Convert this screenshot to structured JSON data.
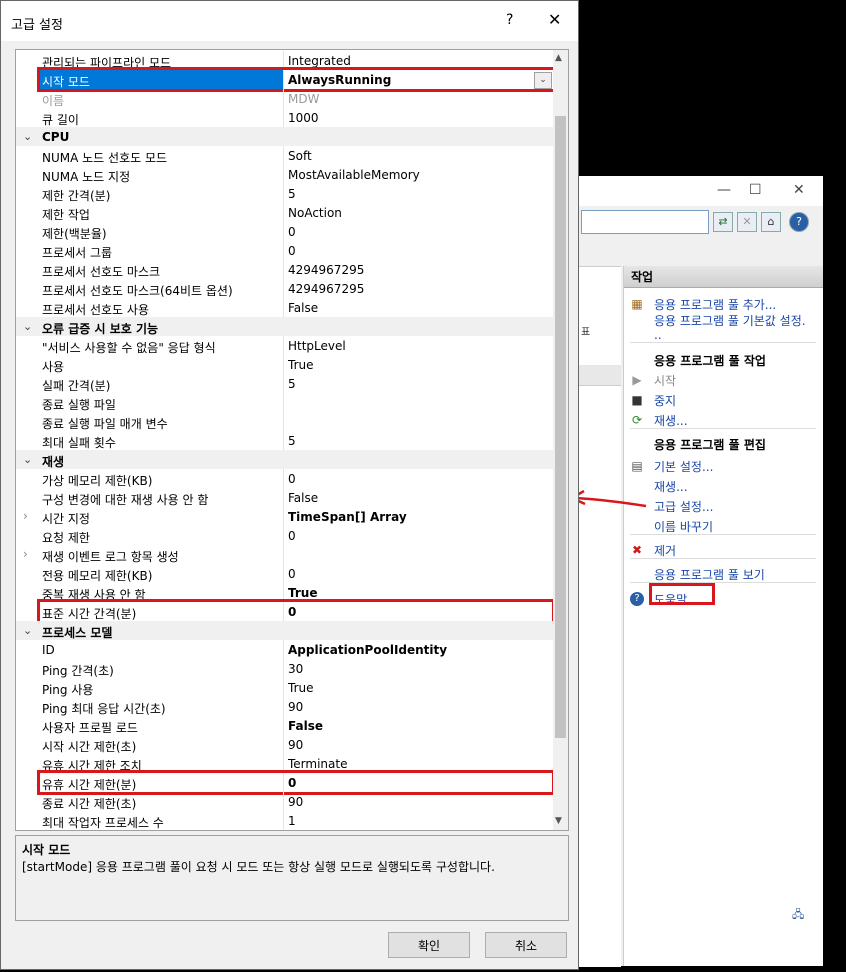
{
  "dialog": {
    "title": "고급 설정",
    "help_label": "?",
    "close_label": "✕",
    "ok_label": "확인",
    "cancel_label": "취소"
  },
  "grid": {
    "rows": [
      {
        "kind": "prop",
        "label": "관리되는 파이프라인 모드",
        "value": "Integrated"
      },
      {
        "kind": "prop",
        "label": "시작 모드",
        "value": "AlwaysRunning",
        "selected": true
      },
      {
        "kind": "prop",
        "label": "이름",
        "value": "MDW",
        "dim": true
      },
      {
        "kind": "prop",
        "label": "큐 길이",
        "value": "1000"
      },
      {
        "kind": "cat",
        "label": "CPU"
      },
      {
        "kind": "prop",
        "label": "NUMA 노드 선호도 모드",
        "value": "Soft"
      },
      {
        "kind": "prop",
        "label": "NUMA 노드 지정",
        "value": "MostAvailableMemory"
      },
      {
        "kind": "prop",
        "label": "제한 간격(분)",
        "value": "5"
      },
      {
        "kind": "prop",
        "label": "제한 작업",
        "value": "NoAction"
      },
      {
        "kind": "prop",
        "label": "제한(백분율)",
        "value": "0"
      },
      {
        "kind": "prop",
        "label": "프로세서 그룹",
        "value": "0"
      },
      {
        "kind": "prop",
        "label": "프로세서 선호도 마스크",
        "value": "4294967295"
      },
      {
        "kind": "prop",
        "label": "프로세서 선호도 마스크(64비트 옵션)",
        "value": "4294967295"
      },
      {
        "kind": "prop",
        "label": "프로세서 선호도 사용",
        "value": "False"
      },
      {
        "kind": "cat",
        "label": "오류 급증 시 보호 기능"
      },
      {
        "kind": "prop",
        "label": "\"서비스 사용할 수 없음\" 응답 형식",
        "value": "HttpLevel"
      },
      {
        "kind": "prop",
        "label": "사용",
        "value": "True"
      },
      {
        "kind": "prop",
        "label": "실패 간격(분)",
        "value": "5"
      },
      {
        "kind": "prop",
        "label": "종료 실행 파일",
        "value": ""
      },
      {
        "kind": "prop",
        "label": "종료 실행 파일 매개 변수",
        "value": ""
      },
      {
        "kind": "prop",
        "label": "최대 실패 횟수",
        "value": "5"
      },
      {
        "kind": "cat",
        "label": "재생"
      },
      {
        "kind": "prop",
        "label": "가상 메모리 제한(KB)",
        "value": "0"
      },
      {
        "kind": "prop",
        "label": "구성 변경에 대한 재생 사용 안 함",
        "value": "False"
      },
      {
        "kind": "prop",
        "label": "시간 지정",
        "value": "TimeSpan[] Array",
        "bold": true,
        "expander": true
      },
      {
        "kind": "prop",
        "label": "요청 제한",
        "value": "0"
      },
      {
        "kind": "prop",
        "label": "재생 이벤트 로그 항목 생성",
        "value": "",
        "expander": true
      },
      {
        "kind": "prop",
        "label": "전용 메모리 제한(KB)",
        "value": "0"
      },
      {
        "kind": "prop",
        "label": "중복 재생 사용 안 함",
        "value": "True",
        "bold": true
      },
      {
        "kind": "prop",
        "label": "표준 시간 간격(분)",
        "value": "0",
        "bold": true,
        "highlight": true
      },
      {
        "kind": "cat",
        "label": "프로세스 모델"
      },
      {
        "kind": "prop",
        "label": "ID",
        "value": "ApplicationPoolIdentity",
        "bold": true
      },
      {
        "kind": "prop",
        "label": "Ping 간격(초)",
        "value": "30"
      },
      {
        "kind": "prop",
        "label": "Ping 사용",
        "value": "True"
      },
      {
        "kind": "prop",
        "label": "Ping 최대 응답 시간(초)",
        "value": "90"
      },
      {
        "kind": "prop",
        "label": "사용자 프로필 로드",
        "value": "False",
        "bold": true
      },
      {
        "kind": "prop",
        "label": "시작 시간 제한(초)",
        "value": "90"
      },
      {
        "kind": "prop",
        "label": "유휴 시간 제한 조치",
        "value": "Terminate"
      },
      {
        "kind": "prop",
        "label": "유휴 시간 제한(분)",
        "value": "0",
        "bold": true,
        "highlight": true
      },
      {
        "kind": "prop",
        "label": "종료 시간 제한(초)",
        "value": "90"
      },
      {
        "kind": "prop",
        "label": "최대 작업자 프로세스 수",
        "value": "1"
      }
    ]
  },
  "description": {
    "title": "시작 모드",
    "text": "[startMode] 응용 프로그램 풀이 요청 시 모드 또는 항상 실행 모드로 실행되도록 구성합니다."
  },
  "background_window": {
    "fragment_text": "표",
    "actions": {
      "header": "작업",
      "items": [
        {
          "kind": "link",
          "label": "응용 프로그램 풀 추가...",
          "icon": "add-pool-icon"
        },
        {
          "kind": "link",
          "label": "응용 프로그램 풀 기본값 설정."
        },
        {
          "kind": "link",
          "label": ".."
        },
        {
          "kind": "heading",
          "label": "응용 프로그램 풀 작업"
        },
        {
          "kind": "link",
          "label": "시작",
          "icon": "play-icon",
          "disabled": true
        },
        {
          "kind": "link",
          "label": "중지",
          "icon": "stop-icon"
        },
        {
          "kind": "link",
          "label": "재생...",
          "icon": "recycle-icon"
        },
        {
          "kind": "heading",
          "label": "응용 프로그램 풀 편집"
        },
        {
          "kind": "link",
          "label": "기본 설정...",
          "icon": "settings-icon"
        },
        {
          "kind": "link",
          "label": "재생..."
        },
        {
          "kind": "link",
          "label": "고급 설정...",
          "highlight": true
        },
        {
          "kind": "link",
          "label": "이름 바꾸기"
        },
        {
          "kind": "link",
          "label": "제거",
          "icon": "remove-icon"
        },
        {
          "kind": "link",
          "label": "응용 프로그램 풀 보기"
        },
        {
          "kind": "link",
          "label": "도움말",
          "icon": "help-icon"
        }
      ]
    }
  },
  "colors": {
    "selection": "#0078d7",
    "highlight_box": "#d9161c",
    "link": "#1a47a8"
  }
}
